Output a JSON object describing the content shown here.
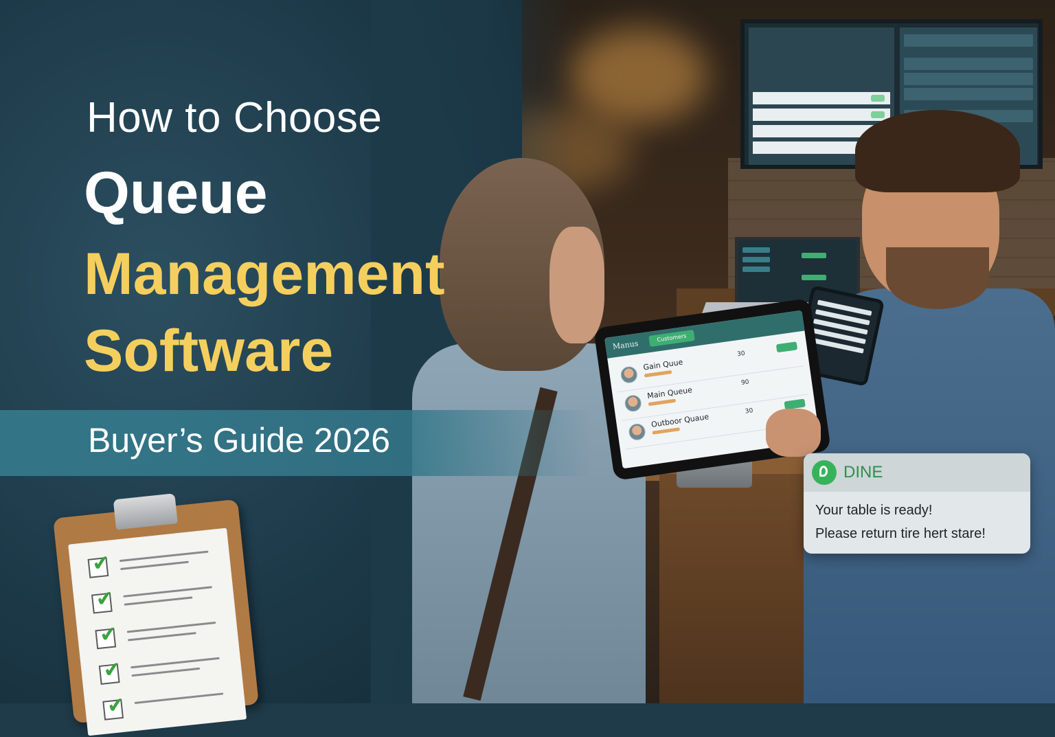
{
  "headline": {
    "line1": "How to Choose",
    "line2": "Queue",
    "line3": "Management",
    "line4": "Software",
    "subtitle": "Buyer’s Guide 2026"
  },
  "colors": {
    "accent_yellow": "#f5cf5e",
    "band_teal": "#34788a",
    "brand_green": "#36b35a",
    "background_navy": "#1f3a48"
  },
  "tablet": {
    "brand": "Manus",
    "chip": "Customers",
    "rows": [
      {
        "name": "Gain Quue",
        "count": "30"
      },
      {
        "name": "Main Queue",
        "count": "90"
      },
      {
        "name": "Outboor Quaue",
        "count": "30"
      }
    ]
  },
  "notification": {
    "icon": "chat-bubble-icon",
    "app_name": "DINE",
    "line1": "Your table is ready!",
    "line2": "Please return tire hert stare!"
  },
  "clipboard": {
    "icon": "checklist-icon",
    "items_checked": 5
  }
}
